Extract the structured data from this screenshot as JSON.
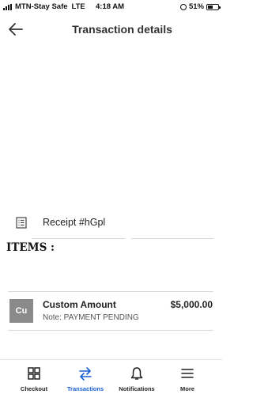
{
  "status_bar": {
    "carrier": "MTN-Stay Safe",
    "network": "LTE",
    "time": "4:18 AM",
    "battery": "51%",
    "battery_level": 0.51
  },
  "header": {
    "title": "Transaction details",
    "back_icon": "back-arrow-icon"
  },
  "receipt": {
    "label": "Receipt #hGpl",
    "icon": "receipt-icon"
  },
  "items": {
    "heading": "ITEMS :",
    "list": [
      {
        "avatar": "Cu",
        "name": "Custom Amount",
        "note": "Note: PAYMENT PENDING",
        "amount": "$5,000.00"
      }
    ]
  },
  "tab_bar": {
    "tabs": [
      {
        "label": "Checkout",
        "icon": "grid-icon"
      },
      {
        "label": "Transactions",
        "icon": "swap-arrows-icon",
        "active": true
      },
      {
        "label": "Notifications",
        "icon": "bell-icon"
      },
      {
        "label": "More",
        "icon": "hamburger-icon"
      }
    ],
    "active_color": "#1a5fd0"
  }
}
